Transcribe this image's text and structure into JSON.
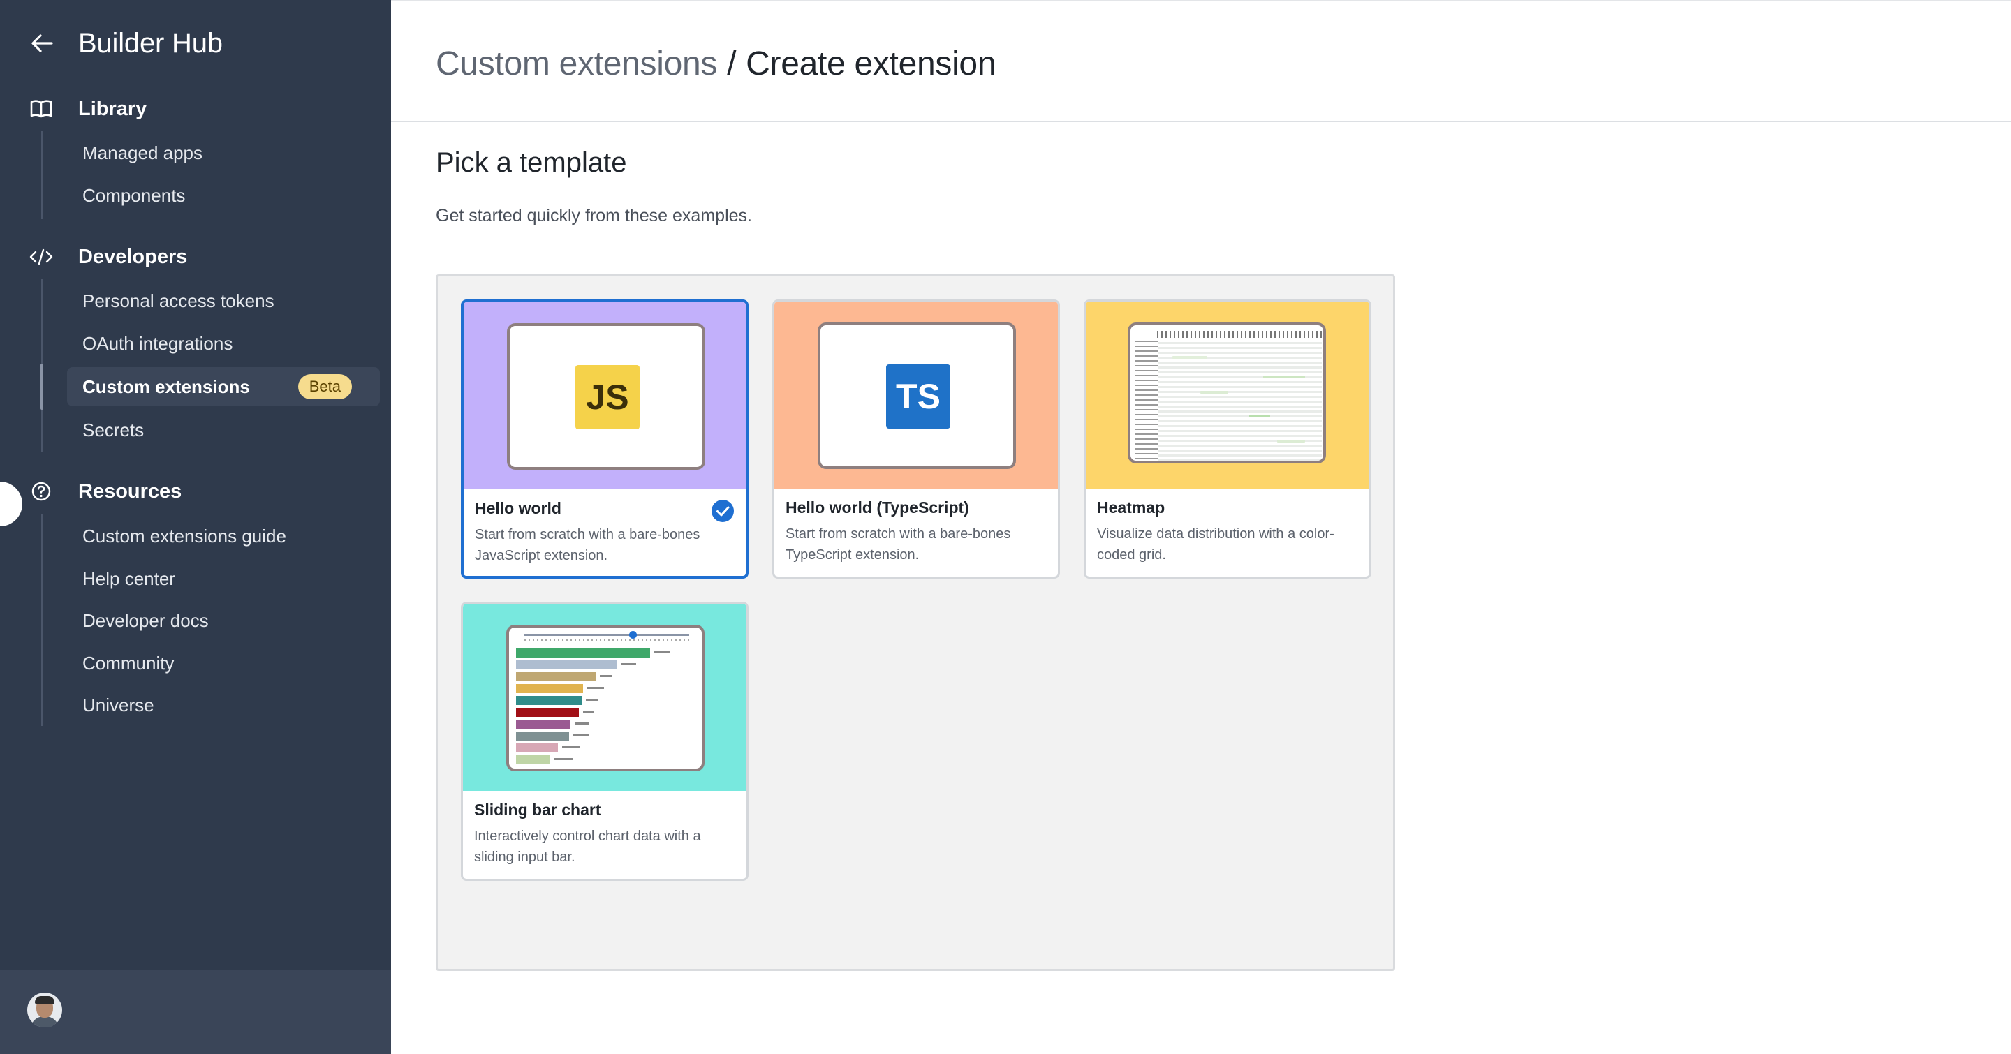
{
  "sidebar": {
    "app_title": "Builder Hub",
    "sections": [
      {
        "label": "Library",
        "icon": "book-icon",
        "items": [
          {
            "label": "Managed apps"
          },
          {
            "label": "Components"
          }
        ]
      },
      {
        "label": "Developers",
        "icon": "code-icon",
        "items": [
          {
            "label": "Personal access tokens"
          },
          {
            "label": "OAuth integrations"
          },
          {
            "label": "Custom extensions",
            "badge": "Beta",
            "active": true
          },
          {
            "label": "Secrets"
          }
        ]
      },
      {
        "label": "Resources",
        "icon": "help-circle-icon",
        "items": [
          {
            "label": "Custom extensions guide"
          },
          {
            "label": "Help center"
          },
          {
            "label": "Developer docs"
          },
          {
            "label": "Community"
          },
          {
            "label": "Universe"
          }
        ]
      }
    ]
  },
  "header": {
    "breadcrumb_parent": "Custom extensions",
    "breadcrumb_separator": "/",
    "breadcrumb_current": "Create extension"
  },
  "templates_section": {
    "title": "Pick a template",
    "subtitle": "Get started quickly from these examples.",
    "cards": [
      {
        "title": "Hello world",
        "description": "Start from scratch with a bare-bones JavaScript extension.",
        "logo": "JS",
        "thumb_color": "#c2b0fb",
        "selected": true
      },
      {
        "title": "Hello world (TypeScript)",
        "description": "Start from scratch with a bare-bones TypeScript extension.",
        "logo": "TS",
        "thumb_color": "#fdb892",
        "selected": false
      },
      {
        "title": "Heatmap",
        "description": "Visualize data distribution with a color-coded grid.",
        "thumb_color": "#fdd56a",
        "selected": false
      },
      {
        "title": "Sliding bar chart",
        "description": "Interactively control chart data with a sliding input bar.",
        "thumb_color": "#78e8de",
        "selected": false
      }
    ]
  },
  "colors": {
    "sidebar_bg": "#2f3a4c",
    "accent": "#1f6fd1",
    "beta_badge": "#f6dc8e"
  }
}
